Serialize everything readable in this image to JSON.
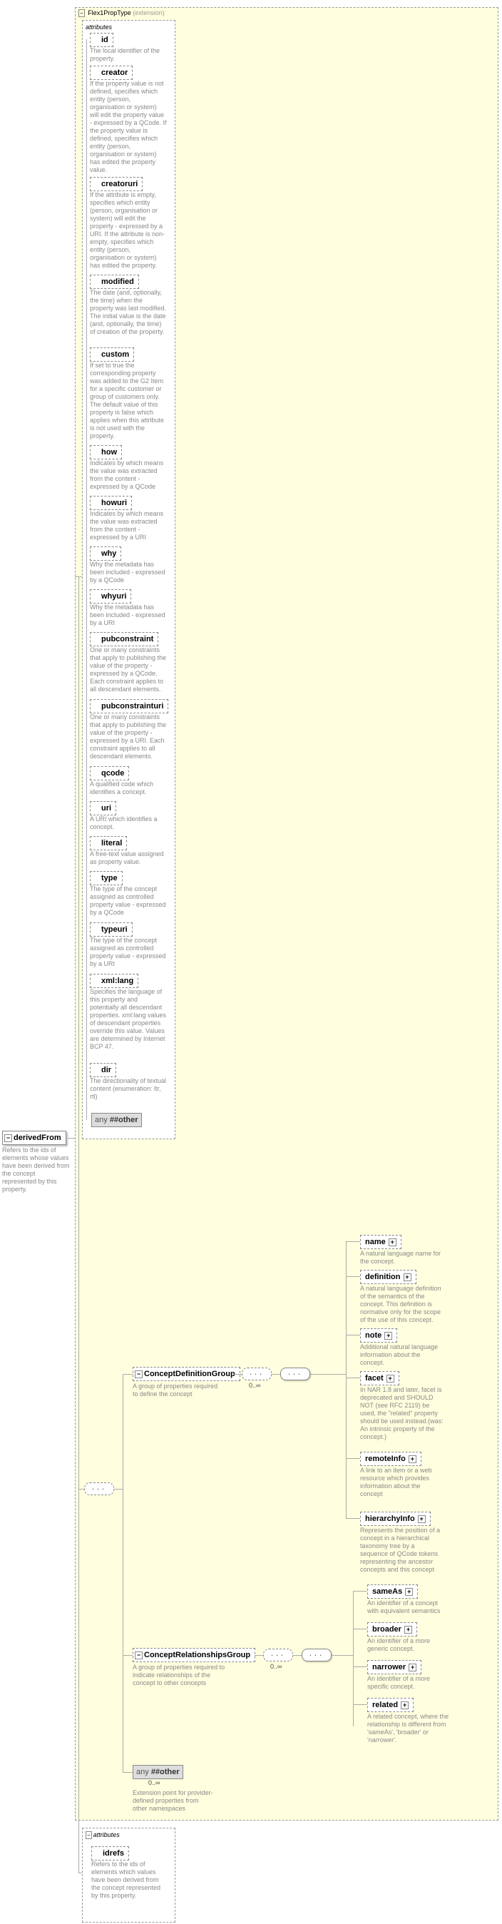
{
  "root": {
    "name": "derivedFrom",
    "desc": "Refers to the ids of elements whose values have been derived from the concept represented by this property."
  },
  "extension": {
    "type_label": "Flex1PropType",
    "suffix": "(extension)"
  },
  "attributes_label": "attributes",
  "attrs": [
    {
      "name": "id",
      "desc": "The local identifier of the property."
    },
    {
      "name": "creator",
      "desc": "If the property value is not defined, specifies which entity (person, organisation or system) will edit the property value - expressed by a QCode. If the property value is defined, specifies which entity (person, organisation or system) has edited the property value."
    },
    {
      "name": "creatoruri",
      "desc": "If the attribute is empty, specifies which entity (person, organisation or system) will edit the property - expressed by a URI. If the attribute is non-empty, specifies which entity (person, organisation or system) has edited the property."
    },
    {
      "name": "modified",
      "desc": "The date (and, optionally, the time) when the property was last modified. The initial value is the date (and, optionally, the time) of creation of the property."
    },
    {
      "name": "custom",
      "desc": "If set to true the corresponding property was added to the G2 Item for a specific customer or group of customers only. The default value of this property is false which applies when this attribute is not used with the property."
    },
    {
      "name": "how",
      "desc": "Indicates by which means the value was extracted from the content - expressed by a QCode"
    },
    {
      "name": "howuri",
      "desc": "Indicates by which means the value was extracted from the content - expressed by a URI"
    },
    {
      "name": "why",
      "desc": "Why the metadata has been included - expressed by a QCode"
    },
    {
      "name": "whyuri",
      "desc": "Why the metadata has been included - expressed by a URI"
    },
    {
      "name": "pubconstraint",
      "desc": "One or many constraints that apply to publishing the value of the property - expressed by a QCode. Each constraint applies to all descendant elements."
    },
    {
      "name": "pubconstrainturi",
      "desc": "One or many constraints that apply to publishing the value of the property - expressed by a URI. Each constraint applies to all descendant elements."
    },
    {
      "name": "qcode",
      "desc": "A qualified code which identifies a concept."
    },
    {
      "name": "uri",
      "desc": "A URI which identifies a concept."
    },
    {
      "name": "literal",
      "desc": "A free-text value assigned as property value."
    },
    {
      "name": "type",
      "desc": "The type of the concept assigned as controlled property value - expressed by a QCode"
    },
    {
      "name": "typeuri",
      "desc": "The type of the concept assigned as controlled property value - expressed by a URI"
    },
    {
      "name": "xml:lang",
      "desc": "Specifies the language of this property and potentially all descendant properties. xml:lang values of descendant properties override this value. Values are determined by Internet BCP 47."
    },
    {
      "name": "dir",
      "desc": "The directionality of textual content (enumeration: ltr, rtl)"
    }
  ],
  "any_label": "any",
  "other_ns": "##other",
  "idrefs_attr": {
    "name": "idrefs",
    "desc": "Refers to the ids of elements which values have been derived from the concept represented by this property."
  },
  "groups": {
    "def": {
      "name": "ConceptDefinitionGroup",
      "desc": "A group of properties required to define the concept",
      "occurs": "0..∞"
    },
    "rel": {
      "name": "ConceptRelationshipsGroup",
      "desc": "A group of properties required to indicate relationships of the concept to other concepts",
      "occurs": "0..∞"
    },
    "any_ext": {
      "desc": "Extension point for provider-defined properties from other namespaces",
      "occurs": "0..∞"
    }
  },
  "def_children": [
    {
      "name": "name",
      "desc": "A natural language name for the concept."
    },
    {
      "name": "definition",
      "desc": "A natural language definition of the semantics of the concept. This definition is normative only for the scope of the use of this concept."
    },
    {
      "name": "note",
      "desc": "Additional natural language information about the concept."
    },
    {
      "name": "facet",
      "desc": "In NAR 1.8 and later, facet is deprecated and SHOULD NOT (see RFC 2119) be used, the \"related\" property should be used instead.(was: An intrinsic property of the concept.)"
    },
    {
      "name": "remoteInfo",
      "desc": "A link to an item or a web resource which provides information about the concept"
    },
    {
      "name": "hierarchyInfo",
      "desc": "Represents the position of a concept in a hierarchical taxonomy tree by a sequence of QCode tokens representing the ancestor concepts and this concept"
    }
  ],
  "rel_children": [
    {
      "name": "sameAs",
      "desc": "An identifier of a concept with equivalent semantics"
    },
    {
      "name": "broader",
      "desc": "An identifier of a more generic concept."
    },
    {
      "name": "narrower",
      "desc": "An identifier of a more specific concept."
    },
    {
      "name": "related",
      "desc": "A related concept, where the relationship is different from 'sameAs', 'broader' or 'narrower'."
    }
  ]
}
